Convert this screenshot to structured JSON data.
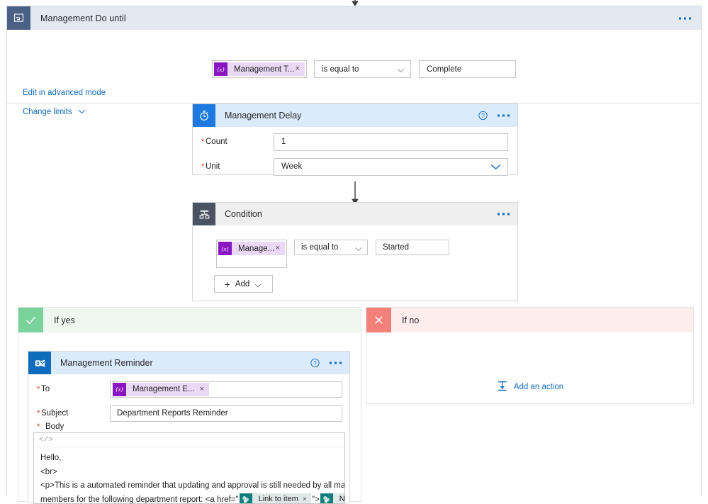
{
  "scope": {
    "title": "Management Do until",
    "icon": "do-until-loop-icon",
    "ellipsis": "more-commands",
    "condition": {
      "token": {
        "icon": "{x}",
        "label": "Management T...",
        "remove": "×"
      },
      "operator": "is equal to",
      "value": "Complete"
    },
    "links": {
      "advanced": "Edit in advanced mode",
      "limits": "Change limits"
    }
  },
  "delay_card": {
    "title": "Management Delay",
    "icon": "timer-icon",
    "help": "?",
    "fields": [
      {
        "label": "Count",
        "required": "*",
        "value": "1",
        "type": "text"
      },
      {
        "label": "Unit",
        "required": "*",
        "value": "Week",
        "type": "select"
      }
    ]
  },
  "condition_card": {
    "title": "Condition",
    "icon": "condition-branch-icon",
    "row": {
      "token": {
        "icon": "{x}",
        "label": "Manage...",
        "remove": "×"
      },
      "operator": "is equal to",
      "value": "Started"
    },
    "add_button": {
      "plus": "+",
      "label": "Add"
    }
  },
  "branch_yes": {
    "title": "If yes",
    "icon": "checkmark-icon"
  },
  "branch_no": {
    "title": "If no",
    "icon": "cross-icon",
    "add_action": "Add an action"
  },
  "mail_card": {
    "title": "Management Reminder",
    "icon": "outlook-icon",
    "help": "?",
    "to": {
      "label": "To",
      "required": "*",
      "token": {
        "icon": "{x}",
        "label": "Management E...",
        "remove": "×"
      }
    },
    "subject": {
      "label": "Subject",
      "required": "*",
      "value": "Department Reports Reminder"
    },
    "body": {
      "label": "Body",
      "required": "*",
      "toolbar_icon": "</>",
      "line1": "Hello,",
      "line2": "<br>",
      "line3a": "<p>This is a automated reminder that updating and approval is still needed by all management team",
      "line3b": "members for the following department report: <a href=\"",
      "token1": {
        "icon": "sharepoint-icon",
        "label": "Link to item",
        "remove": "×"
      },
      "mid": "\">",
      "token2": {
        "icon": "sharepoint-icon",
        "label": "Name",
        "remove": "×"
      }
    }
  },
  "colors": {
    "accent_blue": "#0f6cbd",
    "scope_header": "#e4e8f0",
    "scope_icon": "#4a6084",
    "delay_header": "#dcebfb",
    "delay_icon": "#1f7ae0",
    "condition_header": "#efefef",
    "condition_icon": "#4b5363",
    "yes_icon": "#7ad39a",
    "no_icon": "#f3817a",
    "token_purple": "#8a16c1",
    "token_bg": "#e9d9f7",
    "sharepoint_teal": "#107e7d",
    "required_red": "#d83b01"
  }
}
